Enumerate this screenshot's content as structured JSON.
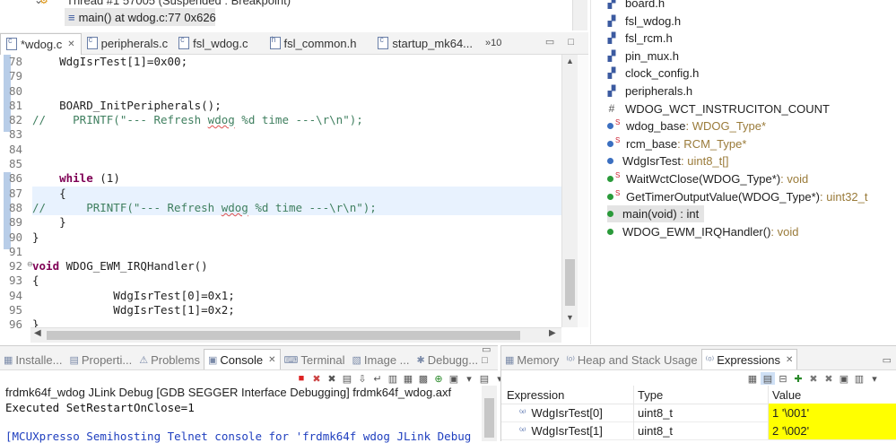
{
  "debug": {
    "thread_label": "Thread #1 57005 (Suspended : Breakpoint)",
    "frame_label": "main() at wdog.c:77 0x626"
  },
  "editor": {
    "tabs": [
      {
        "label": "*wdog.c",
        "active": true
      },
      {
        "label": "peripherals.c"
      },
      {
        "label": "fsl_wdog.c"
      },
      {
        "label": "fsl_common.h"
      },
      {
        "label": "startup_mk64..."
      }
    ],
    "overflow_label": "»10",
    "line_numbers": [
      "78",
      "79",
      "80",
      "81",
      "82",
      "83",
      "84",
      "85",
      "86",
      "87",
      "88",
      "89",
      "90",
      "91",
      "92",
      "93",
      "94",
      "95",
      "96"
    ],
    "lines": [
      "    WdgIsrTest[1]=0x00;",
      "",
      "",
      "    BOARD_InitPeripherals();",
      "//    PRINTF(\"--- Refresh wdog %d time ---\\r\\n\");",
      "",
      "",
      "",
      "    while (1)",
      "    {",
      "//      PRINTF(\"--- Refresh wdog %d time ---\\r\\n\");",
      "    }",
      "}",
      "",
      "void WDOG_EWM_IRQHandler()",
      "{",
      "            WdgIsrTest[0]=0x1;",
      "            WdgIsrTest[1]=0x2;",
      "}"
    ]
  },
  "outline": {
    "items": [
      {
        "kind": "header",
        "label": "board.h"
      },
      {
        "kind": "header",
        "label": "fsl_wdog.h"
      },
      {
        "kind": "header",
        "label": "fsl_rcm.h"
      },
      {
        "kind": "header",
        "label": "pin_mux.h"
      },
      {
        "kind": "header",
        "label": "clock_config.h"
      },
      {
        "kind": "header",
        "label": "peripherals.h"
      },
      {
        "kind": "macro",
        "label": "WDOG_WCT_INSTRUCITON_COUNT"
      },
      {
        "kind": "var-static",
        "label": "wdog_base",
        "type": " : WDOG_Type*"
      },
      {
        "kind": "var-static",
        "label": "rcm_base",
        "type": " : RCM_Type*"
      },
      {
        "kind": "var",
        "label": "WdgIsrTest",
        "type": " : uint8_t[]"
      },
      {
        "kind": "func-static",
        "label": "WaitWctClose(WDOG_Type*)",
        "type": " : void"
      },
      {
        "kind": "func-static",
        "label": "GetTimerOutputValue(WDOG_Type*)",
        "type": " : uint32_t"
      },
      {
        "kind": "func-selected",
        "label": "main(void) : int",
        "type": ""
      },
      {
        "kind": "func",
        "label": "WDOG_EWM_IRQHandler()",
        "type": " : void"
      }
    ]
  },
  "console_panel": {
    "tabs": [
      "Installe...",
      "Properti...",
      "Problems",
      "Console",
      "Terminal",
      "Image ...",
      "Debugg..."
    ],
    "active_tab": "Console",
    "title": "frdmk64f_wdog JLink Debug [GDB SEGGER Interface Debugging] frdmk64f_wdog.axf",
    "line1": "Executed SetRestartOnClose=1",
    "line2": "[MCUXpresso Semihosting Telnet console for 'frdmk64f wdog JLink Debug"
  },
  "expressions_panel": {
    "tabs": [
      "Memory",
      "Heap and Stack Usage",
      "Expressions"
    ],
    "active_tab": "Expressions",
    "columns": [
      "Expression",
      "Type",
      "Value"
    ],
    "rows": [
      {
        "expression": "WdgIsrTest[0]",
        "type": "uint8_t",
        "value": "1 '\\001'"
      },
      {
        "expression": "WdgIsrTest[1]",
        "type": "uint8_t",
        "value": "2 '\\002'"
      }
    ],
    "highlight_color": "#ffff00"
  },
  "colors": {
    "keyword": "#7f0055",
    "comment": "#3f7f5f",
    "current_line": "#e8f2fe",
    "outline_type": "#9a7b3a"
  }
}
